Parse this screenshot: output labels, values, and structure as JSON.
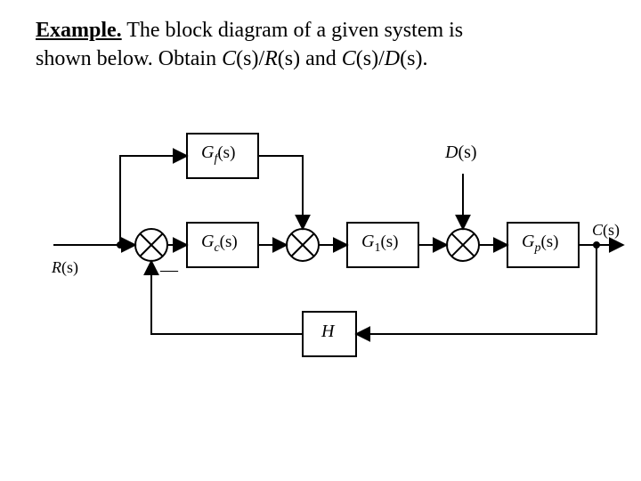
{
  "problem": {
    "heading": "Example.",
    "text_line1": " The block diagram of a given system is ",
    "text_line2_a": "shown below. Obtain ",
    "ratio1": "C",
    "ratio1_arg": "(s)",
    "ratio1_over": "/",
    "ratio1_R": "R",
    "ratio1_Rarg": "(s)",
    "text_and": " and ",
    "ratio2_C": "C",
    "ratio2_Carg": "(s)",
    "ratio2_over": "/",
    "ratio2_D": "D",
    "ratio2_Darg": "(s)",
    "period": "."
  },
  "labels": {
    "R": "R",
    "R_arg": "(s)",
    "Gf": "G",
    "Gf_sub": "f",
    "Gf_arg": "(s)",
    "Gc": "G",
    "Gc_sub": "c",
    "Gc_arg": "(s)",
    "G1": "G",
    "G1_sub": "1",
    "G1_arg": "(s)",
    "Gp": "G",
    "Gp_sub": "p",
    "Gp_arg": "(s)",
    "D": "D",
    "D_arg": "(s)",
    "C": "C",
    "C_arg": "(s)",
    "H": "H",
    "minus": "—"
  },
  "diagram_data": {
    "type": "block-diagram",
    "inputs": [
      "R(s)",
      "D(s)"
    ],
    "output": "C(s)",
    "blocks": [
      "Gf(s)",
      "Gc(s)",
      "G1(s)",
      "Gp(s)",
      "H"
    ],
    "summing_junctions": 3,
    "feedback": "negative via H",
    "feedforward": "R(s) → Gf(s) → summing junction 2",
    "disturbance": "D(s) enters at summing junction 3",
    "forward_path": "R(s) → sum1 → Gc(s) → sum2 → G1(s) → sum3 → Gp(s) → C(s)",
    "feedback_path": "C(s) → H → sum1(−)"
  }
}
